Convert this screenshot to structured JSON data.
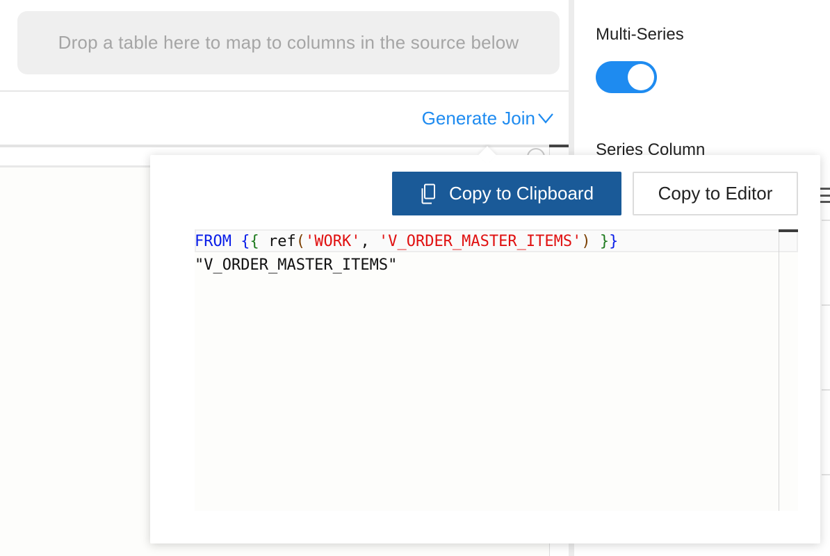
{
  "left_panel": {
    "drop_zone_text": "Drop a table here to map to columns in the source below",
    "generate_join_label": "Generate Join"
  },
  "right_panel": {
    "multi_series_label": "Multi-Series",
    "multi_series_enabled": true,
    "series_column_label": "Series Column"
  },
  "popover": {
    "copy_clipboard_label": "Copy to Clipboard",
    "copy_editor_label": "Copy to Editor",
    "code": {
      "line1": {
        "kw": "FROM",
        "open_braces": "{{",
        "func": "ref",
        "open_paren": "(",
        "arg1": "'WORK'",
        "comma": ",",
        "arg2": "'V_ORDER_MASTER_ITEMS'",
        "close_paren": ")",
        "close_brace_inner": "}",
        "close_brace_outer": "}"
      },
      "line2": "\"V_ORDER_MASTER_ITEMS\""
    }
  },
  "colors": {
    "accent": "#1e8bf0",
    "primary_button": "#1a5a98",
    "keyword": "#0a1ee8",
    "string": "#e01010",
    "brace": "#1e7a1e"
  },
  "icons": [
    "chevron-down-icon",
    "copy-icon",
    "info-icon"
  ]
}
